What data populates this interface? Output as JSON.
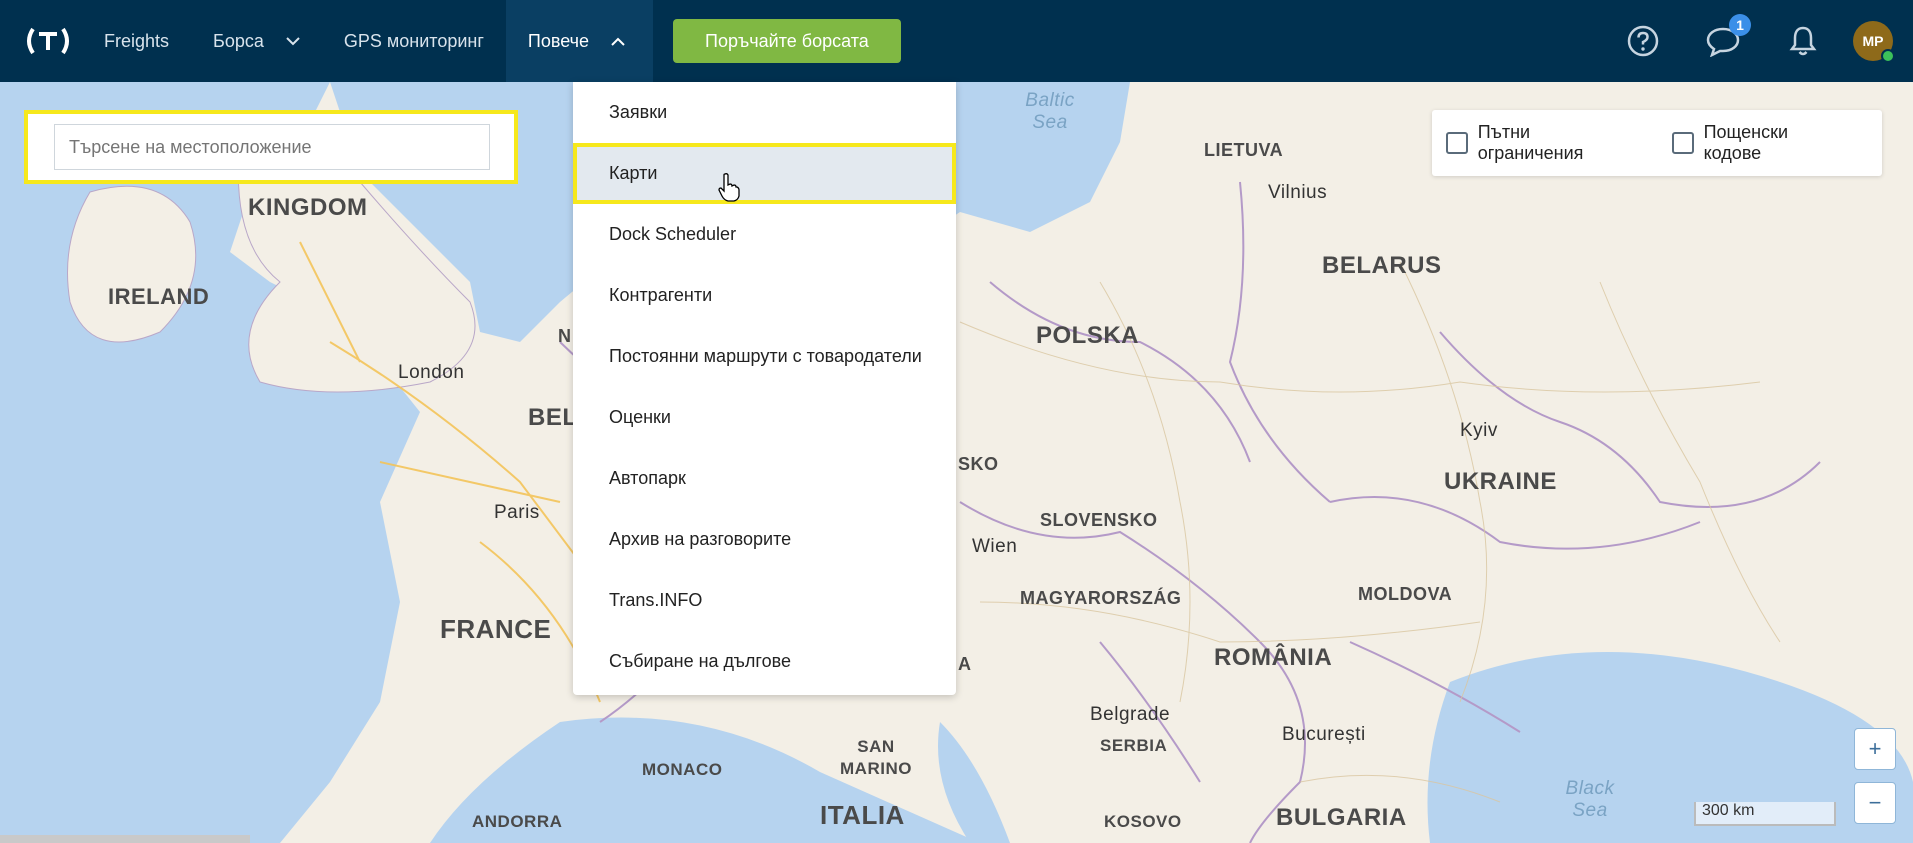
{
  "nav": {
    "items": [
      {
        "label": "Freights"
      },
      {
        "label": "Борса"
      },
      {
        "label": "GPS мониторинг"
      },
      {
        "label": "Повече"
      }
    ],
    "order_button": "Поръчайте борсата",
    "messages_badge": "1",
    "avatar_initials": "MP"
  },
  "search": {
    "placeholder": "Търсене на местоположение"
  },
  "filters": [
    {
      "label": "Пътни ограничения",
      "checked": false
    },
    {
      "label": "Пощенски кодове",
      "checked": false
    }
  ],
  "dropdown": {
    "items": [
      "Заявки",
      "Карти",
      "Dock Scheduler",
      "Контрагенти",
      "Постоянни маршрути с товародатели",
      "Оценки",
      "Автопарк",
      "Архив на разговорите",
      "Trans.INFO",
      "Събиране на дългове"
    ],
    "highlighted_index": 1
  },
  "map": {
    "countries": [
      "KINGDOM",
      "IRELAND",
      "FRANCE",
      "POLSKA",
      "BELARUS",
      "UKRAINE",
      "SLOVENSKO",
      "MAGYARORSZÁG",
      "ROMÂNIA",
      "MOLDOVA",
      "BULGARIA",
      "SERBIA",
      "KOSOVO",
      "ITALIA",
      "MONACO",
      "SAN MARINO",
      "ANDORRA",
      "LIETUVA",
      "BEL",
      "SKO",
      "N",
      "A"
    ],
    "cities": [
      "London",
      "Paris",
      "Wien",
      "Vilnius",
      "Kyiv",
      "Belgrade",
      "București"
    ],
    "seas": [
      "Baltic Sea",
      "Black Sea"
    ],
    "scale": "300 km"
  },
  "zoom": {
    "in": "+",
    "out": "−"
  },
  "colors": {
    "navbar": "#00304f",
    "accent_green": "#80b843",
    "highlight": "#f6e81c",
    "badge": "#3b8fe8"
  }
}
